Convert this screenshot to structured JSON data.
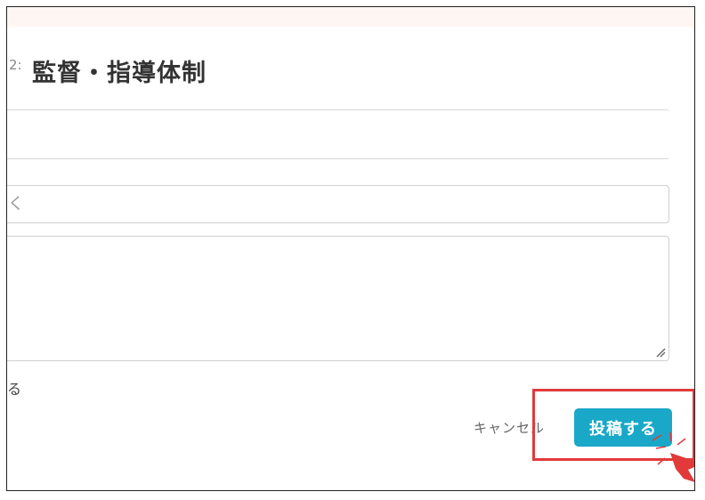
{
  "header": {
    "title_prefix": "2:",
    "title": "監督・指導体制"
  },
  "form": {
    "title_input_text": "く",
    "partial_checkbox_label": "る",
    "cancel_label": "キャンセル",
    "submit_label": "投稿する"
  },
  "colors": {
    "accent": "#1aa8c8",
    "highlight": "#e23a3a",
    "top_strip": "#fdf6f2"
  },
  "icons": {
    "resize": "resize-handle-icon",
    "pointer": "mouse-pointer-icon"
  }
}
